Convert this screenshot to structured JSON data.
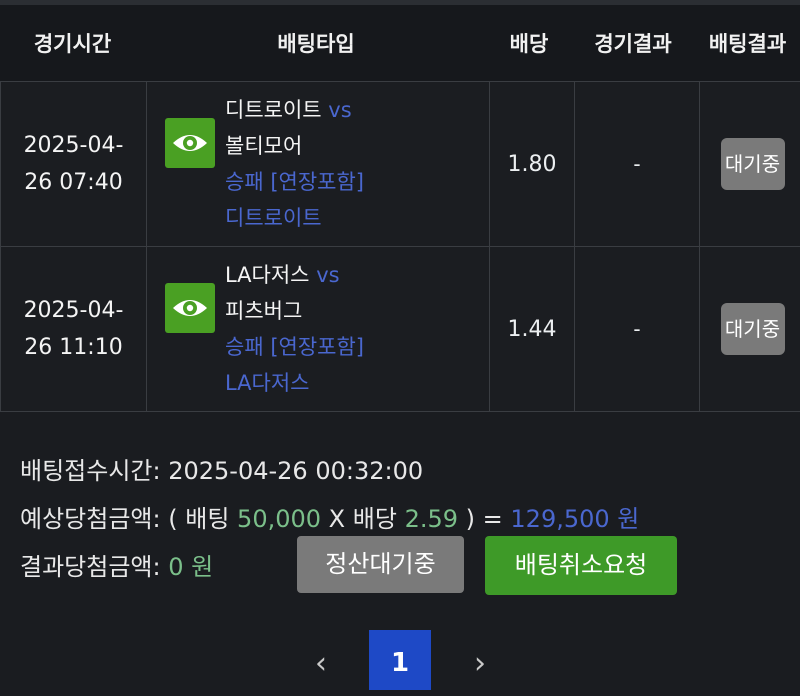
{
  "header": {
    "time": "경기시간",
    "type": "배팅타입",
    "odds": "배당",
    "game_result": "경기결과",
    "bet_result": "배팅결과"
  },
  "rows": [
    {
      "date": "2025-04-",
      "time": "26 07:40",
      "home": "디트로이트",
      "vs": "vs",
      "away": "볼티모어",
      "market": "승패 [연장포함]",
      "pick": "디트로이트",
      "odds": "1.80",
      "game_result": "-",
      "status": "대기중"
    },
    {
      "date": "2025-04-",
      "time": "26 11:10",
      "home": "LA다저스",
      "vs": "vs",
      "away": "피츠버그",
      "market": "승패 [연장포함]",
      "pick": "LA다저스",
      "odds": "1.44",
      "game_result": "-",
      "status": "대기중"
    }
  ],
  "summary": {
    "accept_label": "배팅접수시간:",
    "accept_value": "2025-04-26 00:32:00",
    "expected_label": "예상당첨금액:",
    "open_paren": "(",
    "bet_word": "배팅",
    "bet_amount": "50,000",
    "times": "X",
    "odds_word": "배당",
    "total_odds": "2.59",
    "close_eq": ") =",
    "expected_amount": "129,500 원",
    "result_label": "결과당첨금액:",
    "result_amount": "0 원"
  },
  "buttons": {
    "settle": "정산대기중",
    "cancel": "배팅취소요청"
  },
  "pagination": {
    "prev": "‹",
    "current": "1",
    "next": "›"
  },
  "colors": {
    "background": "#1a1c20",
    "accent_blue": "#4a67cf",
    "green_value": "#7bbf8a",
    "eye_green": "#4aa023",
    "cancel_green": "#3e9a28",
    "page_blue": "#1e49c6"
  }
}
